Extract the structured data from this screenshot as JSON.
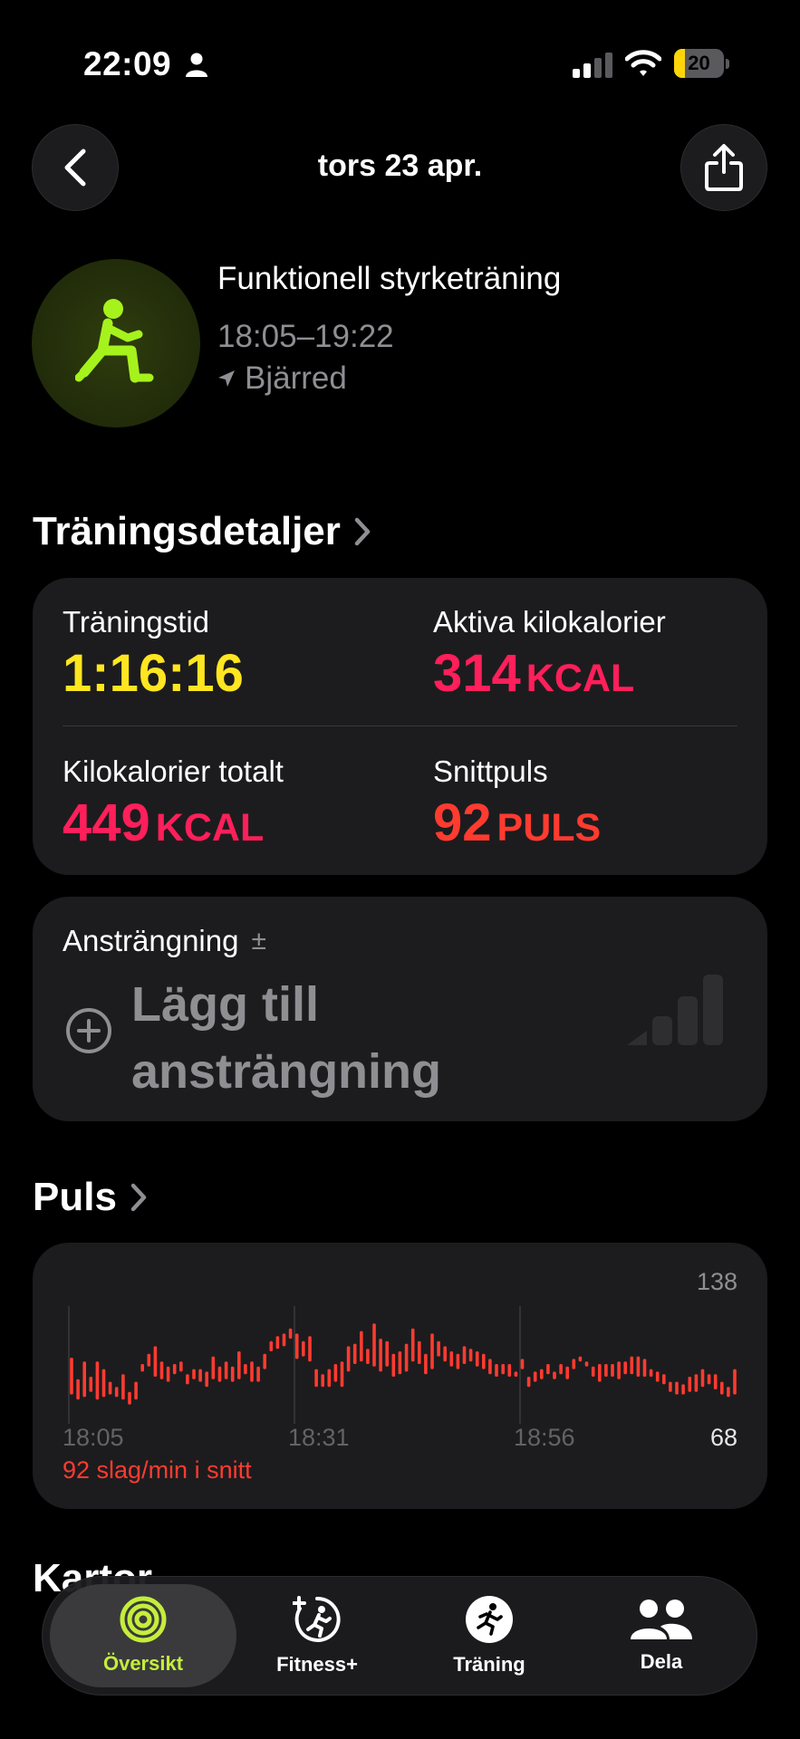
{
  "status_bar": {
    "time": "22:09",
    "battery": "20",
    "battery_color": "#ffd60a"
  },
  "nav": {
    "title": "tors 23 apr.",
    "back_icon": "chevron-left-icon",
    "share_icon": "share-icon"
  },
  "workout": {
    "icon": "functional-strength-icon",
    "name": "Funktionell styrketräning",
    "time_range": "18:05–19:22",
    "location": "Bjärred"
  },
  "details": {
    "section_title": "Träningsdetaljer",
    "metrics": [
      {
        "label": "Träningstid",
        "value": "1:16:16",
        "unit": "",
        "color": "#ffe620"
      },
      {
        "label": "Aktiva kilokalorier",
        "value": "314",
        "unit": "KCAL",
        "color": "#ff1f5a"
      },
      {
        "label": "Kilokalorier totalt",
        "value": "449",
        "unit": "KCAL",
        "color": "#ff1f5a"
      },
      {
        "label": "Snittpuls",
        "value": "92",
        "unit": "PULS",
        "color": "#ff3b30"
      }
    ]
  },
  "effort": {
    "label": "Ansträngning",
    "info_symbol": "±",
    "add_text": "Lägg till ansträngning"
  },
  "puls": {
    "section_title": "Puls",
    "max_label": "138",
    "min_label": "68",
    "ticks": [
      "18:05",
      "18:31",
      "18:56"
    ],
    "average_text": "92 slag/min i snitt"
  },
  "chart_data": {
    "type": "bar",
    "title": "Puls",
    "ylim": [
      68,
      138
    ],
    "x_ticks": [
      "18:05",
      "18:31",
      "18:56"
    ],
    "series_color": "#ff3b30",
    "ranges": [
      [
        74,
        103
      ],
      [
        70,
        86
      ],
      [
        72,
        100
      ],
      [
        76,
        88
      ],
      [
        70,
        100
      ],
      [
        72,
        94
      ],
      [
        74,
        84
      ],
      [
        72,
        80
      ],
      [
        70,
        90
      ],
      [
        66,
        76
      ],
      [
        70,
        84
      ],
      [
        92,
        98
      ],
      [
        96,
        106
      ],
      [
        88,
        112
      ],
      [
        86,
        100
      ],
      [
        84,
        96
      ],
      [
        90,
        98
      ],
      [
        92,
        100
      ],
      [
        82,
        90
      ],
      [
        86,
        94
      ],
      [
        84,
        94
      ],
      [
        80,
        92
      ],
      [
        86,
        104
      ],
      [
        84,
        96
      ],
      [
        86,
        100
      ],
      [
        84,
        96
      ],
      [
        86,
        108
      ],
      [
        90,
        98
      ],
      [
        84,
        100
      ],
      [
        84,
        96
      ],
      [
        94,
        106
      ],
      [
        108,
        116
      ],
      [
        110,
        120
      ],
      [
        112,
        122
      ],
      [
        118,
        126
      ],
      [
        102,
        122
      ],
      [
        104,
        116
      ],
      [
        100,
        120
      ],
      [
        80,
        94
      ],
      [
        80,
        90
      ],
      [
        80,
        94
      ],
      [
        84,
        98
      ],
      [
        80,
        100
      ],
      [
        92,
        112
      ],
      [
        98,
        114
      ],
      [
        100,
        124
      ],
      [
        98,
        110
      ],
      [
        96,
        130
      ],
      [
        92,
        118
      ],
      [
        96,
        116
      ],
      [
        88,
        106
      ],
      [
        90,
        108
      ],
      [
        92,
        114
      ],
      [
        100,
        126
      ],
      [
        98,
        116
      ],
      [
        90,
        106
      ],
      [
        94,
        122
      ],
      [
        104,
        116
      ],
      [
        100,
        112
      ],
      [
        96,
        108
      ],
      [
        94,
        106
      ],
      [
        98,
        112
      ],
      [
        100,
        110
      ],
      [
        96,
        108
      ],
      [
        94,
        106
      ],
      [
        90,
        102
      ],
      [
        88,
        98
      ],
      [
        90,
        98
      ],
      [
        88,
        98
      ],
      [
        88,
        92
      ],
      [
        94,
        102
      ],
      [
        80,
        88
      ],
      [
        84,
        92
      ],
      [
        86,
        94
      ],
      [
        90,
        98
      ],
      [
        86,
        92
      ],
      [
        90,
        98
      ],
      [
        86,
        96
      ],
      [
        94,
        102
      ],
      [
        100,
        104
      ],
      [
        96,
        100
      ],
      [
        88,
        96
      ],
      [
        84,
        98
      ],
      [
        88,
        98
      ],
      [
        88,
        98
      ],
      [
        86,
        100
      ],
      [
        90,
        100
      ],
      [
        90,
        104
      ],
      [
        88,
        104
      ],
      [
        88,
        102
      ],
      [
        88,
        94
      ],
      [
        84,
        92
      ],
      [
        82,
        90
      ],
      [
        76,
        84
      ],
      [
        74,
        84
      ],
      [
        74,
        82
      ],
      [
        76,
        88
      ],
      [
        76,
        90
      ],
      [
        80,
        94
      ],
      [
        82,
        90
      ],
      [
        78,
        90
      ],
      [
        74,
        84
      ],
      [
        72,
        80
      ],
      [
        74,
        94
      ]
    ]
  },
  "next_section_peek": "Kartor",
  "tabbar": {
    "tabs": [
      {
        "label": "Översikt",
        "icon": "activity-rings-icon",
        "active": true
      },
      {
        "label": "Fitness+",
        "icon": "fitness-plus-icon",
        "active": false
      },
      {
        "label": "Träning",
        "icon": "workout-runner-icon",
        "active": false
      },
      {
        "label": "Dela",
        "icon": "people-icon",
        "active": false
      }
    ],
    "active_color": "#c5ee3b"
  }
}
